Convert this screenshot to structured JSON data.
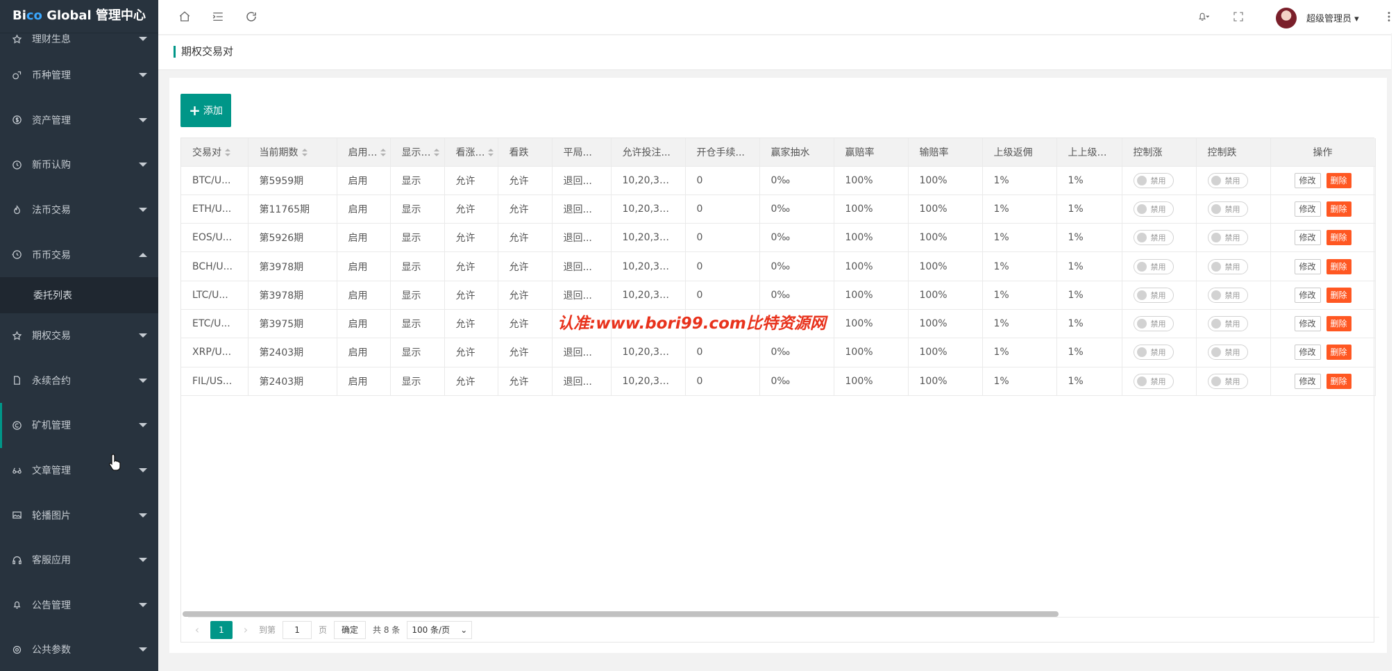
{
  "app": {
    "logo_prefix": "Bi",
    "logo_accent": "co",
    "logo_suffix": " Global 管理中心"
  },
  "sidebar": {
    "items": [
      {
        "label": "理财生息",
        "icon": "star-icon",
        "expanded": false
      },
      {
        "label": "币种管理",
        "icon": "coin-icon",
        "expanded": false
      },
      {
        "label": "资产管理",
        "icon": "dollar-icon",
        "expanded": false
      },
      {
        "label": "新币认购",
        "icon": "clock-icon",
        "expanded": false
      },
      {
        "label": "法币交易",
        "icon": "fire-icon",
        "expanded": false
      },
      {
        "label": "币币交易",
        "icon": "history-icon",
        "expanded": true
      },
      {
        "label": "期权交易",
        "icon": "star-icon",
        "expanded": false
      },
      {
        "label": "永续合约",
        "icon": "file-icon",
        "expanded": false
      },
      {
        "label": "矿机管理",
        "icon": "c-icon",
        "expanded": false
      },
      {
        "label": "文章管理",
        "icon": "read-icon",
        "expanded": false
      },
      {
        "label": "轮播图片",
        "icon": "image-icon",
        "expanded": false
      },
      {
        "label": "客服应用",
        "icon": "headset-icon",
        "expanded": false
      },
      {
        "label": "公告管理",
        "icon": "bell-icon",
        "expanded": false
      },
      {
        "label": "公共参数",
        "icon": "setting-icon",
        "expanded": false
      }
    ],
    "submenu_label": "委托列表"
  },
  "header": {
    "user_name": "超级管理员"
  },
  "breadcrumb": {
    "title": "期权交易对"
  },
  "toolbar": {
    "add_label": "添加",
    "add_plus": "+"
  },
  "table": {
    "columns": [
      "交易对",
      "当前期数",
      "启用...",
      "显示...",
      "看涨...",
      "看跌",
      "平局...",
      "允许投注...",
      "开仓手续...",
      "赢家抽水",
      "赢赔率",
      "输赔率",
      "上级返佣",
      "上上级返佣",
      "控制涨",
      "控制跌",
      "操作"
    ],
    "rows": [
      [
        "BTC/U...",
        "第5959期",
        "启用",
        "显示",
        "允许",
        "允许",
        "退回...",
        "10,20,30...",
        "0",
        "0‰",
        "100%",
        "100%",
        "1%",
        "1%"
      ],
      [
        "ETH/U...",
        "第11765期",
        "启用",
        "显示",
        "允许",
        "允许",
        "退回...",
        "10,20,30...",
        "0",
        "0‰",
        "100%",
        "100%",
        "1%",
        "1%"
      ],
      [
        "EOS/U...",
        "第5926期",
        "启用",
        "显示",
        "允许",
        "允许",
        "退回...",
        "10,20,30...",
        "0",
        "0‰",
        "100%",
        "100%",
        "1%",
        "1%"
      ],
      [
        "BCH/U...",
        "第3978期",
        "启用",
        "显示",
        "允许",
        "允许",
        "退回...",
        "10,20,30...",
        "0",
        "0‰",
        "100%",
        "100%",
        "1%",
        "1%"
      ],
      [
        "LTC/U...",
        "第3978期",
        "启用",
        "显示",
        "允许",
        "允许",
        "退回...",
        "10,20,30...",
        "0",
        "0‰",
        "100%",
        "100%",
        "1%",
        "1%"
      ],
      [
        "ETC/U...",
        "第3975期",
        "启用",
        "显示",
        "允许",
        "允许",
        "",
        "",
        "",
        "",
        "100%",
        "100%",
        "1%",
        "1%"
      ],
      [
        "XRP/U...",
        "第2403期",
        "启用",
        "显示",
        "允许",
        "允许",
        "退回...",
        "10,20,30...",
        "0",
        "0‰",
        "100%",
        "100%",
        "1%",
        "1%"
      ],
      [
        "FIL/US...",
        "第2403期",
        "启用",
        "显示",
        "允许",
        "允许",
        "退回...",
        "10,20,30...",
        "0",
        "0‰",
        "100%",
        "100%",
        "1%",
        "1%"
      ]
    ],
    "switch_label": "禁用",
    "edit_label": "修改",
    "delete_label": "删除"
  },
  "pagination": {
    "current_page": "1",
    "goto_prefix": "到第",
    "goto_value": "1",
    "goto_suffix": "页",
    "confirm_label": "确定",
    "total": "共 8 条",
    "page_size": "100 条/页"
  },
  "watermark": "认准:www.bori99.com比特资源网",
  "colors": {
    "sidebar_bg": "#28333e",
    "primary": "#009688",
    "danger": "#ff5722",
    "watermark": "#e8321c"
  }
}
